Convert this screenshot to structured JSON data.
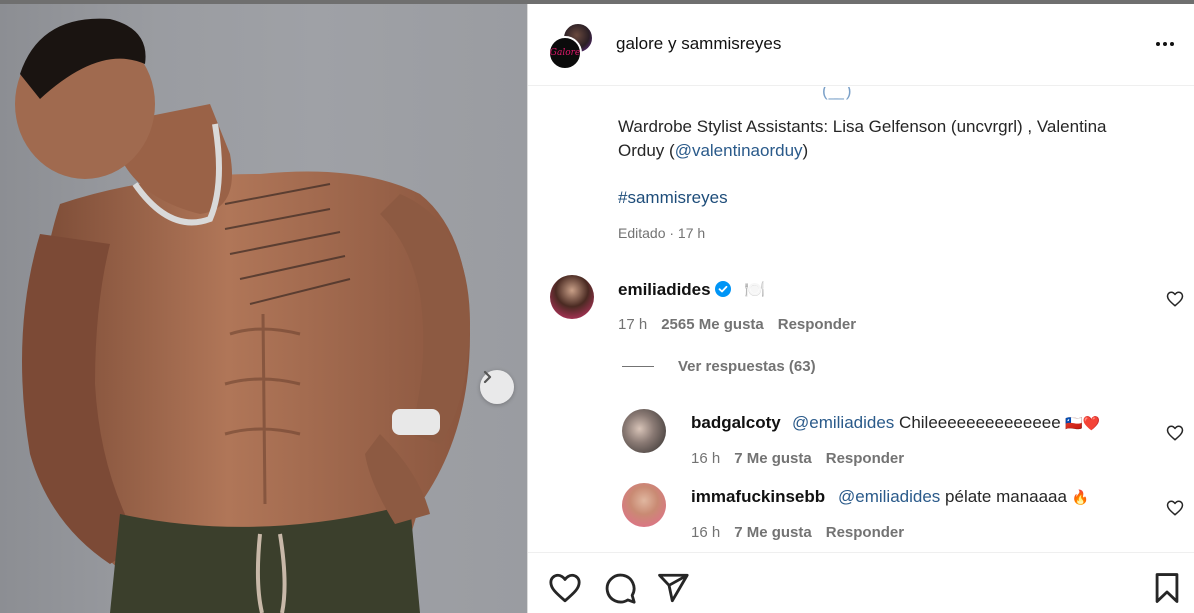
{
  "post": {
    "authors": "galore y sammisreyes",
    "avatar_front_text": "Galore",
    "caption_prefix": "Wardrobe Stylist Assistants: Lisa Gelfenson (uncvrgrl) , Valentina Orduy (",
    "caption_mention": "@valentinaorduy",
    "caption_suffix": ")",
    "hashtag": "#sammisreyes",
    "edited_meta": "Editado · 17 h",
    "more_icon": "more-options-icon",
    "next_icon": "chevron-right-icon"
  },
  "comments": [
    {
      "username": "emiliadides",
      "text": "🍽️",
      "time": "17 h",
      "likes": "2565 Me gusta",
      "reply_label": "Responder",
      "verified": true
    }
  ],
  "view_replies": "Ver respuestas (63)",
  "replies": [
    {
      "username": "badgalcoty",
      "mention": "@emiliadides",
      "text": " Chileeeeeeeeeeeeee",
      "emoji": "🇨🇱❤️",
      "time": "16 h",
      "likes": "7 Me gusta",
      "reply_label": "Responder"
    },
    {
      "username": "immafuckinsebb",
      "mention": "@emiliadides",
      "text": " pélate manaaaa",
      "emoji": "🔥",
      "time": "16 h",
      "likes": "7 Me gusta",
      "reply_label": "Responder"
    }
  ],
  "actions": {
    "like_icon": "heart-icon",
    "comment_icon": "comment-icon",
    "share_icon": "send-icon",
    "save_icon": "bookmark-icon"
  },
  "colors": {
    "link": "#1e4d7a",
    "verified": "#0095f6",
    "muted": "#737373"
  }
}
